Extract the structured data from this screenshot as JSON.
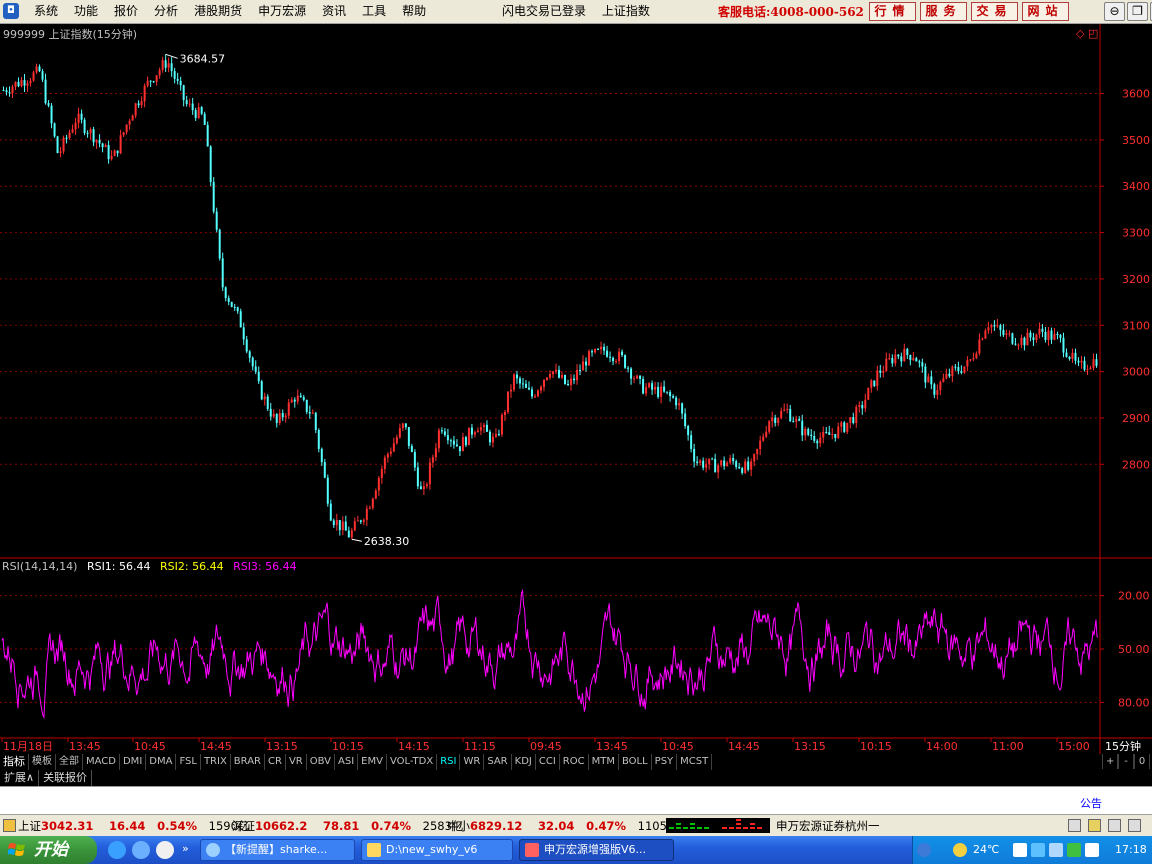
{
  "menubar": {
    "menus": [
      "系统",
      "功能",
      "报价",
      "分析",
      "港股期货",
      "申万宏源",
      "资讯",
      "工具",
      "帮助"
    ],
    "status": [
      "闪电交易已登录",
      "上证指数"
    ],
    "hotline": "客服电话:4008-000-562",
    "quick_buttons": [
      "行情",
      "服务",
      "交易",
      "网站"
    ]
  },
  "chart": {
    "title": "999999 上证指数(15分钟)",
    "high_label": "3684.57",
    "low_label": "2638.30",
    "price_axis": [
      "3600",
      "3500",
      "3400",
      "3300",
      "3200",
      "3100",
      "3000",
      "2900",
      "2800"
    ],
    "rsi_title": "RSI(14,14,14)",
    "rsi1": "RSI1: 56.44",
    "rsi2": "RSI2: 56.44",
    "rsi3": "RSI3: 56.44",
    "rsi_axis": [
      "80.00",
      "50.00",
      "20.00"
    ],
    "time_axis": [
      "11月18日",
      "13:45",
      "10:45",
      "14:45",
      "13:15",
      "10:15",
      "14:15",
      "11:15",
      "09:45",
      "13:45",
      "10:45",
      "14:45",
      "13:15",
      "10:15",
      "14:00",
      "11:00",
      "15:00"
    ],
    "period": "15分钟",
    "colors": {
      "up": "#ff3030",
      "down": "#54ffff",
      "rsi": "#ff00ff",
      "grid": "#8b0000",
      "rsi2": "#ffff00"
    }
  },
  "chart_data": {
    "type": "candlestick",
    "title": "999999 上证指数(15分钟)",
    "ylim": [
      2600,
      3750
    ],
    "yticks": [
      2800,
      2900,
      3000,
      3100,
      3200,
      3300,
      3400,
      3500,
      3600
    ],
    "close_trend": [
      3620,
      3640,
      3660,
      3480,
      3560,
      3520,
      3470,
      3570,
      3640,
      3684,
      3590,
      3560,
      3200,
      3120,
      2980,
      2900,
      2960,
      2920,
      2700,
      2660,
      2720,
      2830,
      2900,
      2740,
      2900,
      2850,
      2900,
      2860,
      3000,
      2960,
      3020,
      2980,
      3040,
      3060,
      3040,
      2980,
      2970,
      2950,
      2820,
      2810,
      2820,
      2800,
      2910,
      2930,
      2880,
      2870,
      2890,
      2930,
      3010,
      3050,
      3050,
      2970,
      3010,
      3030,
      3120,
      3090,
      3080,
      3100,
      3080,
      3020,
      3040
    ],
    "annotations": {
      "max": 3684.57,
      "min": 2638.3
    },
    "rsi": {
      "params": [
        14,
        14,
        14
      ],
      "last": 56.44,
      "ylim": [
        0,
        100
      ],
      "yticks": [
        20,
        50,
        80
      ]
    }
  },
  "tabs": {
    "items": [
      "指标",
      "模板",
      "全部",
      "MACD",
      "DMI",
      "DMA",
      "FSL",
      "TRIX",
      "BRAR",
      "CR",
      "VR",
      "OBV",
      "ASI",
      "EMV",
      "VOL-TDX",
      "RSI",
      "WR",
      "SAR",
      "KDJ",
      "CCI",
      "ROC",
      "MTM",
      "BOLL",
      "PSY",
      "MCST"
    ],
    "active": "RSI",
    "controls": [
      "+",
      "-",
      "0"
    ],
    "ext": [
      "扩展∧",
      "关联报价"
    ]
  },
  "notice": "公告",
  "statusbar": {
    "sh_name": "上证",
    "sh_value": "3042.31",
    "sh_change": "16.44",
    "sh_pct": "0.54%",
    "sh_vol": "1590亿",
    "sz_name": "深证",
    "sz_value": "10662.2",
    "sz_change": "78.81",
    "sz_pct": "0.74%",
    "sz_vol": "2583亿",
    "zx_name": "中小",
    "zx_value": "6829.12",
    "zx_change": "32.04",
    "zx_pct": "0.47%",
    "zx_vol": "1105亿",
    "broker": "申万宏源证券杭州一"
  },
  "taskbar": {
    "start": "开始",
    "tasks": [
      "【新提醒】sharke...",
      "D:\\new_swhy_v6",
      "申万宏源增强版V6..."
    ],
    "temp": "24℃",
    "clock": "17:18"
  }
}
